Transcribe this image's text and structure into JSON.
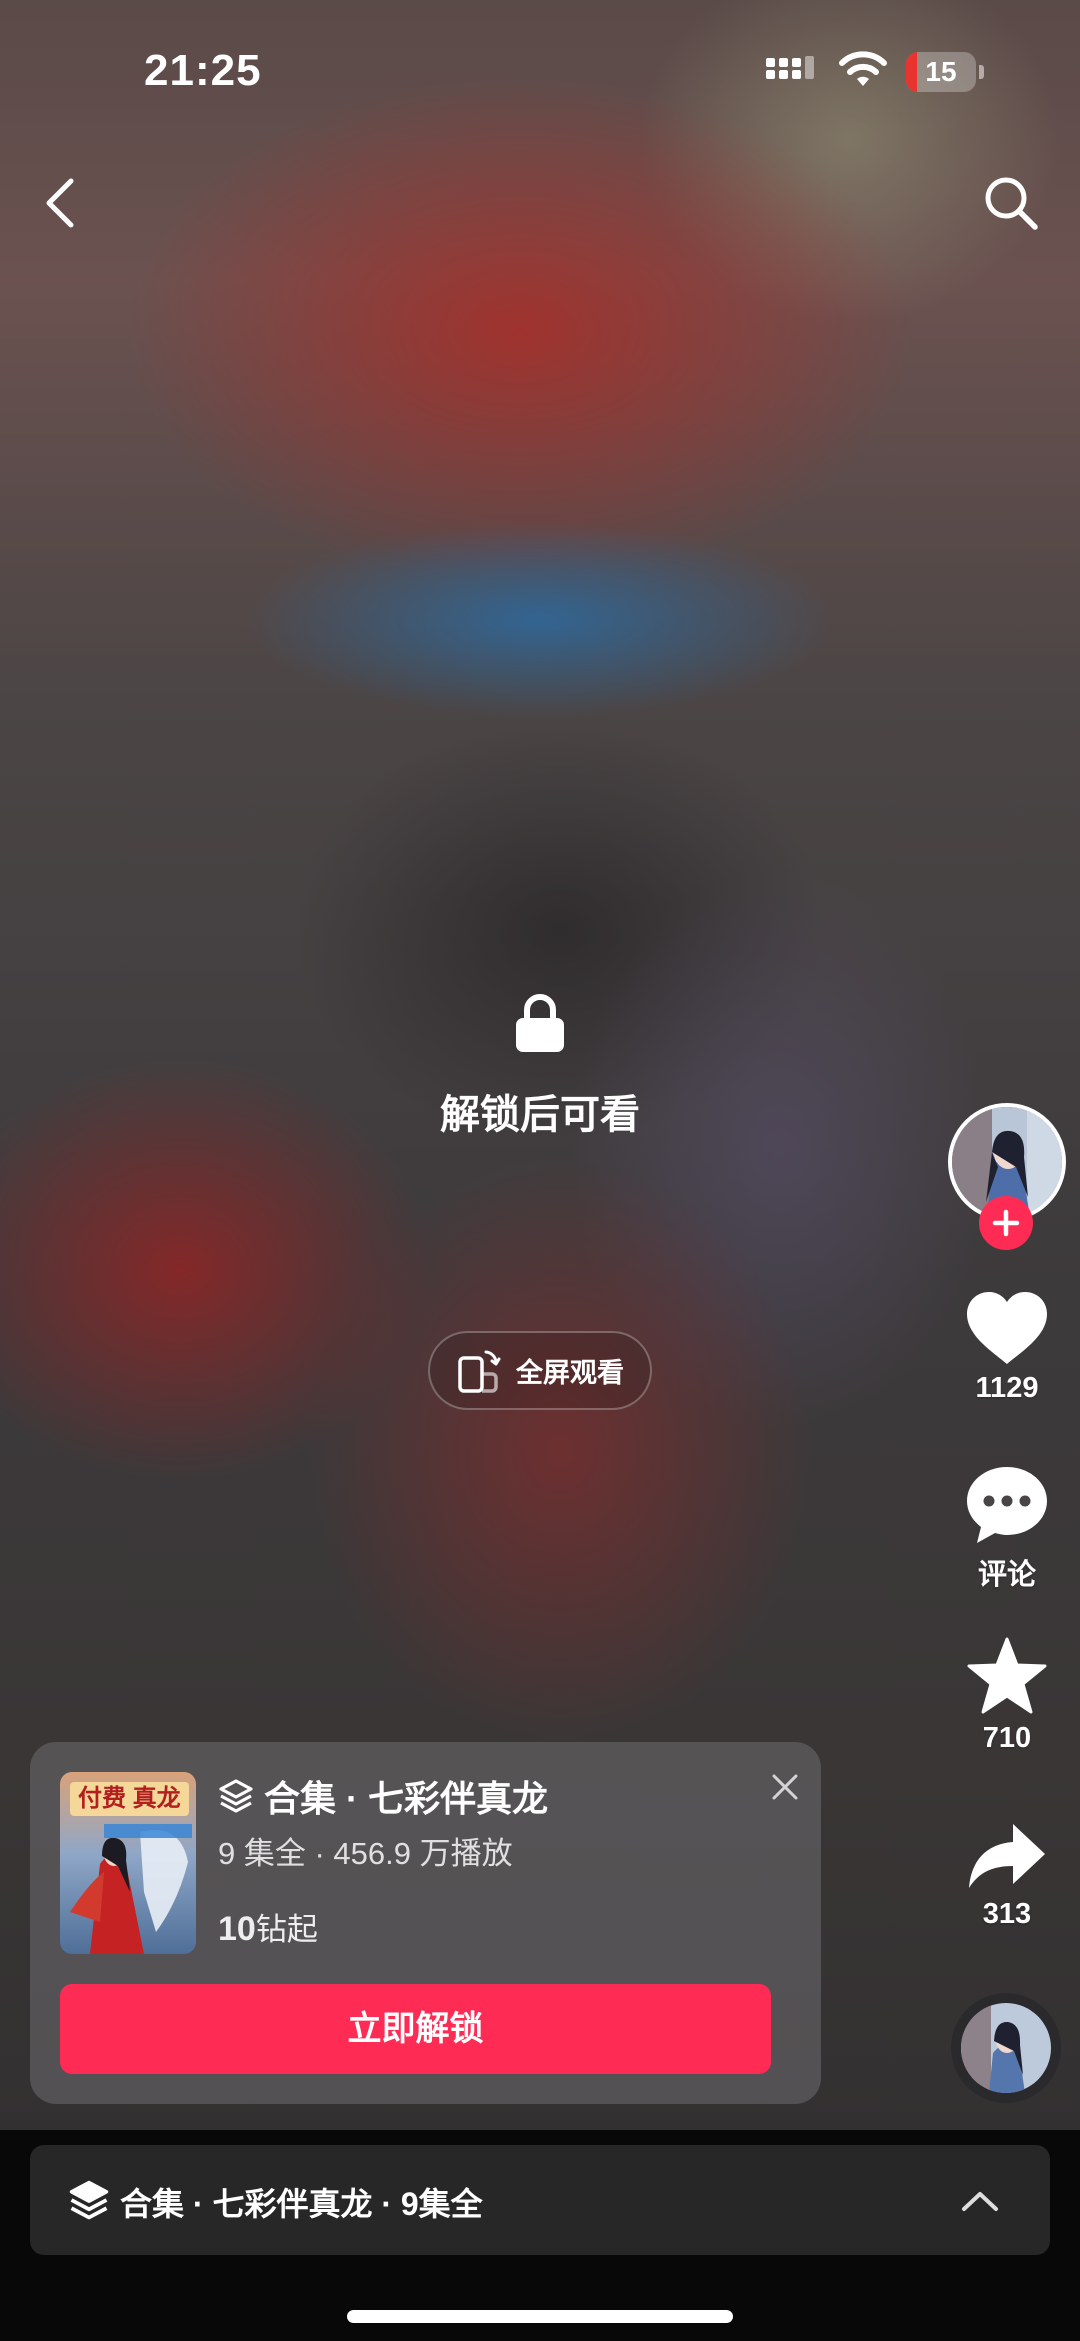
{
  "status_bar": {
    "time": "21:25",
    "battery_level": "15",
    "battery_color": "#e8332e",
    "icons": [
      "signal-icon",
      "wifi-icon",
      "battery-icon"
    ]
  },
  "nav": {
    "back_icon": "chevron-left-icon",
    "search_icon": "search-icon"
  },
  "player": {
    "lock_icon": "lock-icon",
    "unlock_hint": "解锁后可看",
    "fullscreen_label": "全屏观看",
    "fullscreen_icon": "rotate-phone-icon"
  },
  "rail": {
    "follow_icon": "plus-icon",
    "like_count": "1129",
    "comment_label": "评论",
    "favorite_count": "710",
    "share_count": "313",
    "accent_color": "#fe2c55"
  },
  "unlock_card": {
    "cover_badge": "付费 真龙",
    "title": "合集 · 七彩伴真龙",
    "meta": "9 集全 · 456.9 万播放",
    "price_amount": "10",
    "price_unit": "钻起",
    "unlock_button": "立即解锁",
    "close_icon": "close-icon"
  },
  "bottom_bar": {
    "collection_label": "合集 · 七彩伴真龙 · 9集全",
    "expand_icon": "chevron-up-icon"
  }
}
